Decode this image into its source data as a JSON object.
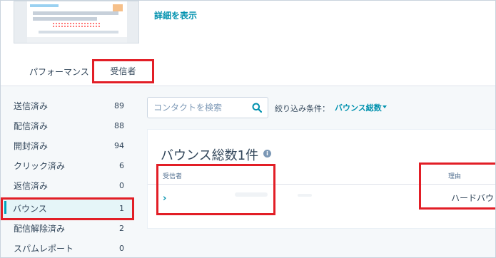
{
  "header": {
    "details_link": "詳細を表示"
  },
  "tabs": [
    {
      "label": "パフォーマンス"
    },
    {
      "label": "受信者"
    }
  ],
  "sidebar": {
    "items": [
      {
        "label": "送信済み",
        "count": "89"
      },
      {
        "label": "配信済み",
        "count": "88"
      },
      {
        "label": "開封済み",
        "count": "94"
      },
      {
        "label": "クリック済み",
        "count": "6"
      },
      {
        "label": "返信済み",
        "count": "0"
      },
      {
        "label": "バウンス",
        "count": "1"
      },
      {
        "label": "配信解除済み",
        "count": "2"
      },
      {
        "label": "スパムレポート",
        "count": "0"
      }
    ]
  },
  "search": {
    "placeholder": "コンタクトを検索"
  },
  "filter": {
    "label": "絞り込み条件：",
    "value": "バウンス総数"
  },
  "card": {
    "title": "バウンス総数1件",
    "info_icon": "i",
    "columns": {
      "recipient": "受信者",
      "reason": "理由"
    },
    "rows": [
      {
        "expand": "›",
        "reason": "ハードバウンス"
      }
    ]
  },
  "colors": {
    "accent": "#0091ae",
    "highlight": "#e21e26",
    "active_bar": "#00a4bd",
    "sidebar_bg": "#f5f8fa"
  },
  "icons": {
    "search": "search-icon",
    "info": "info-icon",
    "dropdown": "chevron-down-icon",
    "expand": "chevron-right-icon"
  }
}
